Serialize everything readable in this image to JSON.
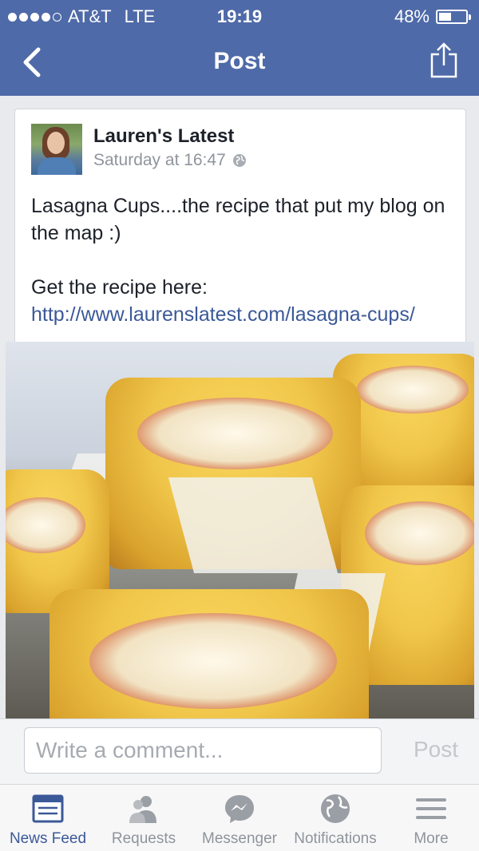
{
  "status_bar": {
    "carrier": "AT&T",
    "network": "LTE",
    "time": "19:19",
    "battery": "48%",
    "battery_level": 0.48
  },
  "nav": {
    "title": "Post",
    "back_icon": "chevron-left-icon",
    "share_icon": "share-icon"
  },
  "post": {
    "author": "Lauren's Latest",
    "timestamp": "Saturday at 16:47",
    "privacy_icon": "globe-icon",
    "text_line1": "Lasagna Cups....the recipe that put my blog on the map :)",
    "text_prefix": "Get the recipe here: ",
    "link": "http://www.laurenslatest.com/lasagna-cups/"
  },
  "comment": {
    "placeholder": "Write a comment...",
    "post_label": "Post"
  },
  "tabs": [
    {
      "label": "News Feed",
      "icon": "news-feed-icon",
      "active": true
    },
    {
      "label": "Requests",
      "icon": "requests-icon",
      "active": false
    },
    {
      "label": "Messenger",
      "icon": "messenger-icon",
      "active": false
    },
    {
      "label": "Notifications",
      "icon": "notifications-globe-icon",
      "active": false
    },
    {
      "label": "More",
      "icon": "more-menu-icon",
      "active": false
    }
  ],
  "colors": {
    "header": "#4f6aa8",
    "link": "#3b5998",
    "tab_inactive": "#8f949b"
  }
}
